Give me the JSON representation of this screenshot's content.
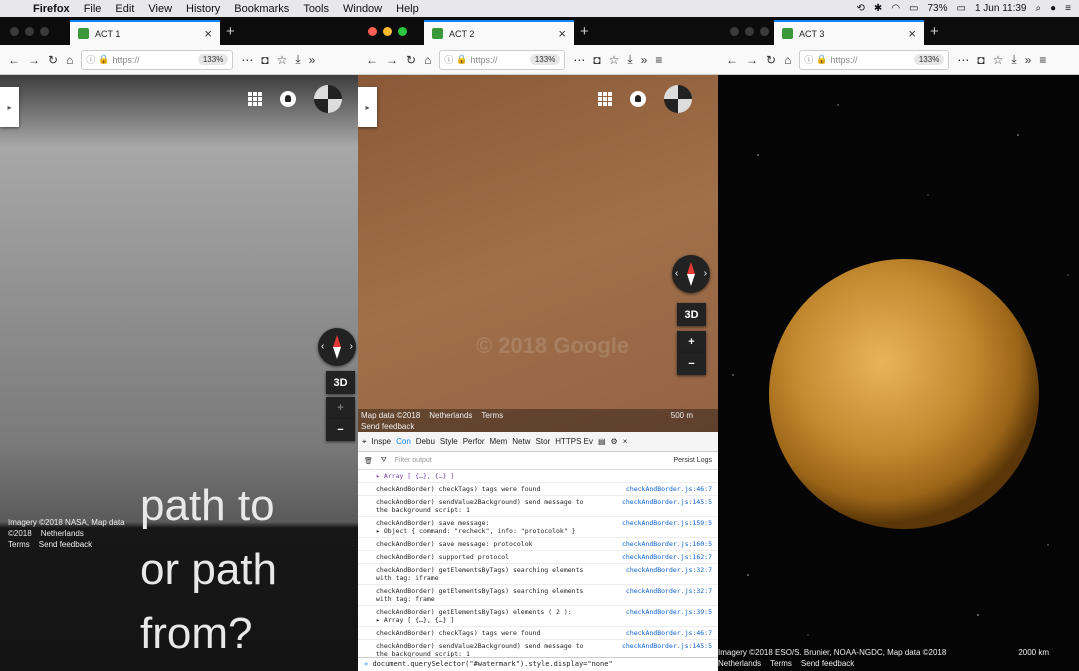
{
  "menubar": {
    "app": "Firefox",
    "items": [
      "File",
      "Edit",
      "View",
      "History",
      "Bookmarks",
      "Tools",
      "Window",
      "Help"
    ],
    "battery": "73%",
    "datetime": "1 Jun 11:39"
  },
  "windows": [
    {
      "tab_title": "ACT 1",
      "url": "https://",
      "zoom": "133%"
    },
    {
      "tab_title": "ACT 2",
      "url": "https://",
      "zoom": "133%"
    },
    {
      "tab_title": "ACT 3",
      "url": "https://",
      "zoom": "133%"
    }
  ],
  "map_controls": {
    "three_d": "3D",
    "zoom_in": "+",
    "zoom_out": "−"
  },
  "win1": {
    "footer_line1": "Imagery ©2018 NASA, Map data",
    "footer_line2": "©2018",
    "footer_region": "Netherlands",
    "terms": "Terms",
    "feedback": "Send feedback",
    "big_text": [
      "path to",
      "or path",
      "from?"
    ]
  },
  "win2": {
    "watermark": "© 2018 Google",
    "footer_map_data": "Map data ©2018",
    "footer_region": "Netherlands",
    "terms": "Terms",
    "scale": "500 m",
    "feedback": "Send feedback",
    "devtools": {
      "tabs": [
        "Inspe",
        "Con",
        "Debu",
        "Style",
        "Perfor",
        "Mem",
        "Netw",
        "Stor",
        "HTTPS Ev"
      ],
      "filter_placeholder": "Filter output",
      "persist_logs": "Persist Logs",
      "logs": [
        {
          "msg": "▸ Array [ {…}, {…} ]",
          "src": ""
        },
        {
          "msg": "checkAndBorder) checkTags) tags were found",
          "src": "checkAndBorder.js:46:7"
        },
        {
          "msg": "checkAndBorder) sendValue2Background) send message to\nthe background script: 1",
          "src": "checkAndBorder.js:145:5"
        },
        {
          "msg": "checkAndBorder) save message:\n▸ Object { command: \"recheck\", info: \"protocolok\" }",
          "src": "checkAndBorder.js:159:5"
        },
        {
          "msg": "checkAndBorder) save message: protocolok",
          "src": "checkAndBorder.js:160:5"
        },
        {
          "msg": "checkAndBorder) supported protocol",
          "src": "checkAndBorder.js:162:7"
        },
        {
          "msg": "checkAndBorder) getElementsByTags) searching elements\nwith tag: iframe",
          "src": "checkAndBorder.js:32:7"
        },
        {
          "msg": "checkAndBorder) getElementsByTags) searching elements\nwith tag: frame",
          "src": "checkAndBorder.js:32:7"
        },
        {
          "msg": "checkAndBorder) getElementsByTags) elements ( 2 ):\n▸ Array [ {…}, {…} ]",
          "src": "checkAndBorder.js:39:5"
        },
        {
          "msg": "checkAndBorder) checkTags) tags were found",
          "src": "checkAndBorder.js:46:7"
        },
        {
          "msg": "checkAndBorder) sendValue2Background) send message to\nthe background script: 1",
          "src": "checkAndBorder.js:145:5"
        }
      ],
      "console_input": "document.querySelector(\"#watermark\").style.display=\"none\""
    }
  },
  "win3": {
    "footer": "Imagery ©2018 ESO/S. Brunier, NOAA-NGDC, Map data ©2018",
    "footer_region": "Netherlands",
    "terms": "Terms",
    "feedback": "Send feedback",
    "scale": "2000 km"
  }
}
